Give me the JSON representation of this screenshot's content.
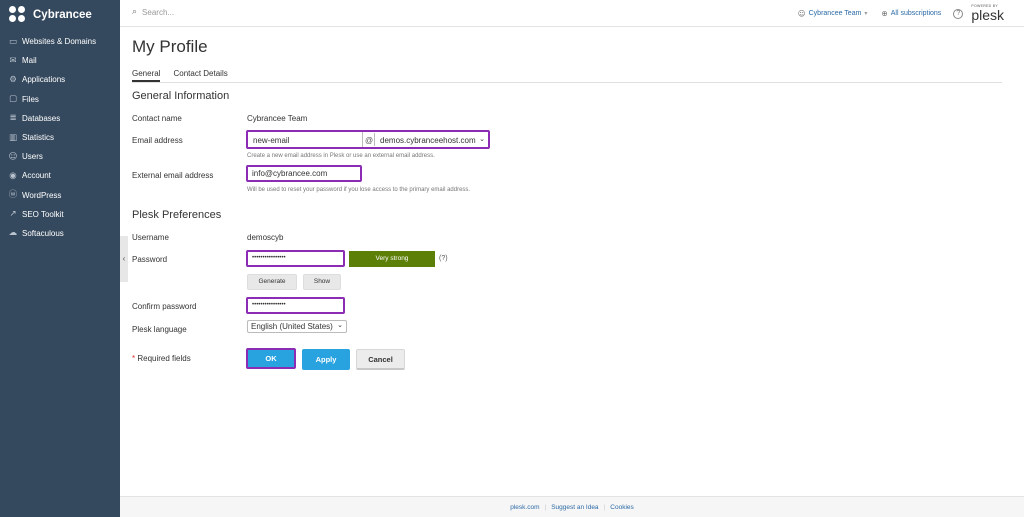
{
  "brand": {
    "name": "Cybrancee"
  },
  "sidebar": {
    "items": [
      {
        "label": "Websites & Domains",
        "icon": "monitor-icon"
      },
      {
        "label": "Mail",
        "icon": "mail-icon"
      },
      {
        "label": "Applications",
        "icon": "applications-icon"
      },
      {
        "label": "Files",
        "icon": "folder-icon"
      },
      {
        "label": "Databases",
        "icon": "database-icon"
      },
      {
        "label": "Statistics",
        "icon": "statistics-icon"
      },
      {
        "label": "Users",
        "icon": "user-icon"
      },
      {
        "label": "Account",
        "icon": "account-icon"
      },
      {
        "label": "WordPress",
        "icon": "wordpress-icon"
      },
      {
        "label": "SEO Toolkit",
        "icon": "seo-icon"
      },
      {
        "label": "Softaculous",
        "icon": "softaculous-icon"
      }
    ]
  },
  "header": {
    "search_placeholder": "Search...",
    "user": "Cybrancee Team",
    "subscriptions": "All subscriptions",
    "help": "?",
    "powered_by": "POWERED BY",
    "plesk": "plesk"
  },
  "page": {
    "title": "My Profile",
    "tabs": [
      {
        "label": "General",
        "active": true
      },
      {
        "label": "Contact Details",
        "active": false
      }
    ]
  },
  "general": {
    "title": "General Information",
    "contact_name_label": "Contact name",
    "contact_name_value": "Cybrancee Team",
    "email_label": "Email address",
    "email_local": "new-email",
    "at": "@",
    "email_domain": "demos.cybranceehost.com",
    "email_hint": "Create a new email address in Plesk or use an external email address.",
    "external_label": "External email address",
    "external_value": "info@cybrancee.com",
    "external_hint": "Will be used to reset your password if you lose access to the primary email address."
  },
  "prefs": {
    "title": "Plesk Preferences",
    "username_label": "Username",
    "username_value": "demoscyb",
    "password_label": "Password",
    "password_value": "••••••••••••••••",
    "strength": "Very strong",
    "strength_help": "(?)",
    "generate": "Generate",
    "show": "Show",
    "confirm_label": "Confirm password",
    "confirm_value": "••••••••••••••••",
    "language_label": "Plesk language",
    "language_value": "English (United States)"
  },
  "form": {
    "required_star": "*",
    "required_text": "Required fields",
    "ok": "OK",
    "apply": "Apply",
    "cancel": "Cancel"
  },
  "footer": {
    "links": [
      "plesk.com",
      "Suggest an Idea",
      "Cookies"
    ]
  },
  "colors": {
    "sidebar_bg": "#35495e",
    "highlight": "#8c2cb5",
    "primary_button": "#29a3df",
    "strength_bar": "#5b7f07"
  }
}
